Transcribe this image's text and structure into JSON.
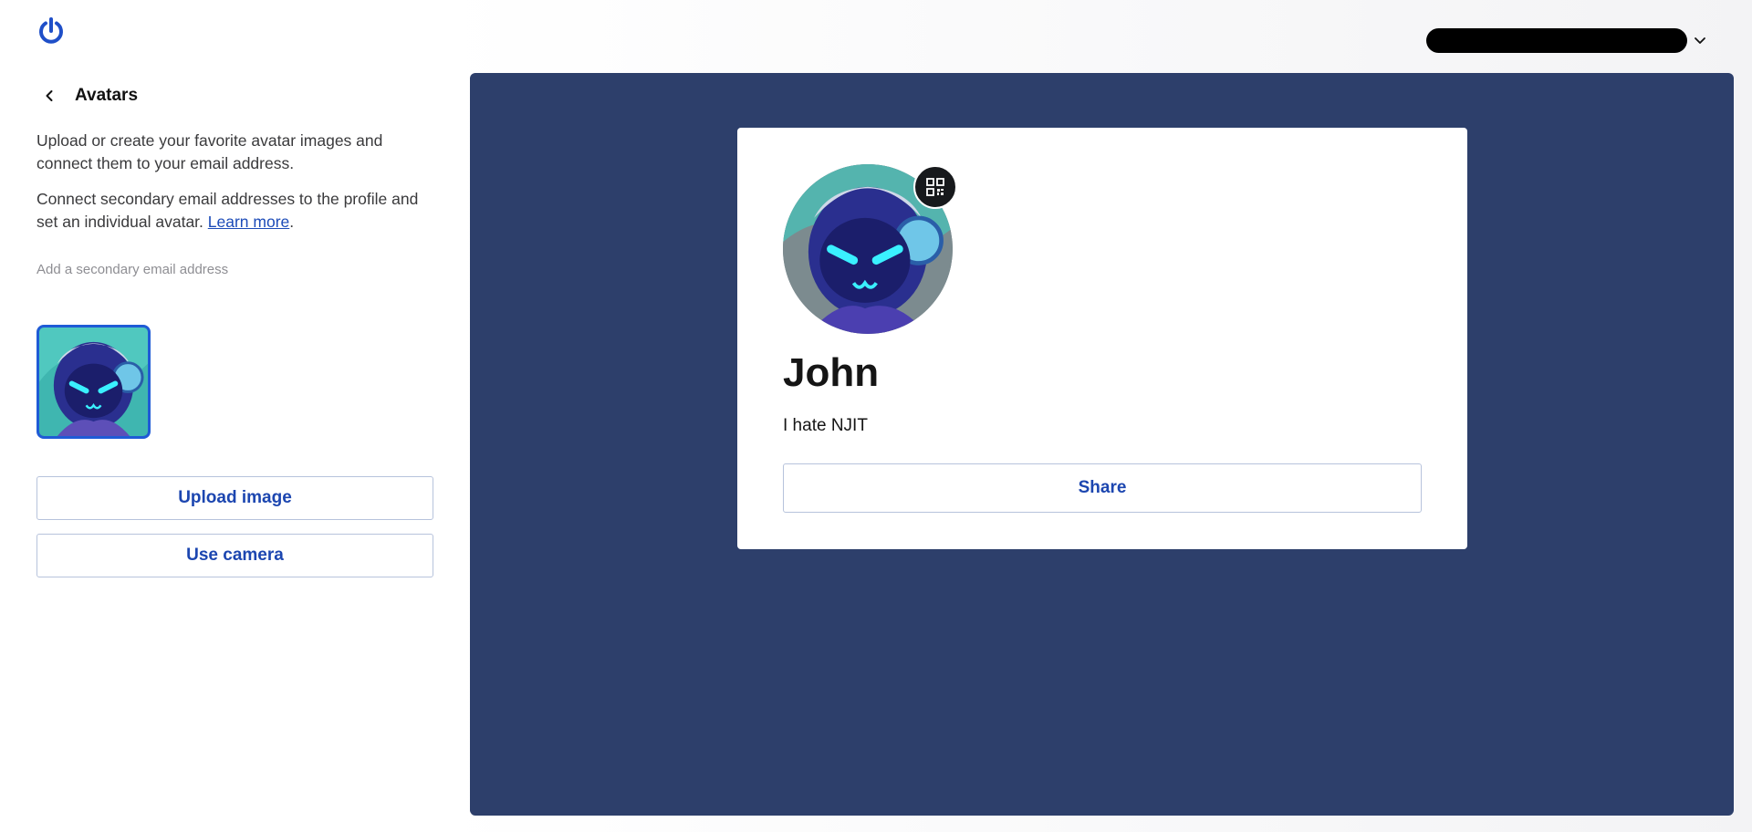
{
  "header": {
    "logo_icon": "power-icon",
    "account_label": "",
    "account_chevron_icon": "chevron-down-icon"
  },
  "sidebar": {
    "back_icon": "chevron-left-icon",
    "title": "Avatars",
    "description": "Upload or create your favorite avatar images and connect them to your email address.",
    "secondary_text_before_link": "Connect secondary email addresses to the profile and set an individual avatar. ",
    "learn_more_label": "Learn more",
    "secondary_text_after_link": ".",
    "add_secondary_email_label": "Add a secondary email address",
    "upload_button_label": "Upload image",
    "camera_button_label": "Use camera"
  },
  "preview_card": {
    "name": "John",
    "bio": "I hate NJIT",
    "share_label": "Share",
    "qr_icon": "qr-code-icon"
  },
  "colors": {
    "accent": "#1c46b0",
    "preview_background": "#2d3f6b",
    "selected_border": "#1f5bd6"
  }
}
